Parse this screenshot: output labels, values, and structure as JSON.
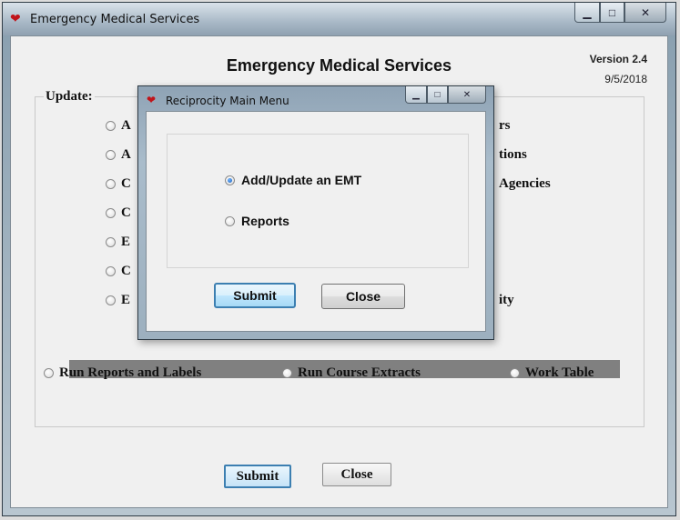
{
  "main_window": {
    "title": "Emergency Medical Services",
    "controls": {
      "minimize": "▁",
      "maximize": "□",
      "close": "✕"
    },
    "app_title": "Emergency Medical Services",
    "version": "Version 2.4",
    "date": "9/5/2018",
    "update_label": "Update:",
    "update_options_visible": {
      "left": [
        "A",
        "A",
        "C",
        "C",
        "E",
        "C",
        "E"
      ],
      "right": [
        "rs",
        "tions",
        "Agencies",
        "ity"
      ]
    },
    "bottom_options": [
      "Run Reports and Labels",
      "Run Course Extracts",
      "Work Table"
    ],
    "submit_label": "Submit",
    "close_label": "Close"
  },
  "dialog": {
    "title": "Reciprocity Main Menu",
    "controls": {
      "minimize": "▁",
      "maximize": "□",
      "close": "✕"
    },
    "options": [
      {
        "label": "Add/Update an EMT",
        "selected": true
      },
      {
        "label": "Reports",
        "selected": false
      }
    ],
    "submit_label": "Submit",
    "close_label": "Close"
  },
  "icons": {
    "app": "heart-icon"
  },
  "colors": {
    "icon_red": "#c0141a",
    "focus_border": "#3c7fb1",
    "divider": "#808080"
  }
}
